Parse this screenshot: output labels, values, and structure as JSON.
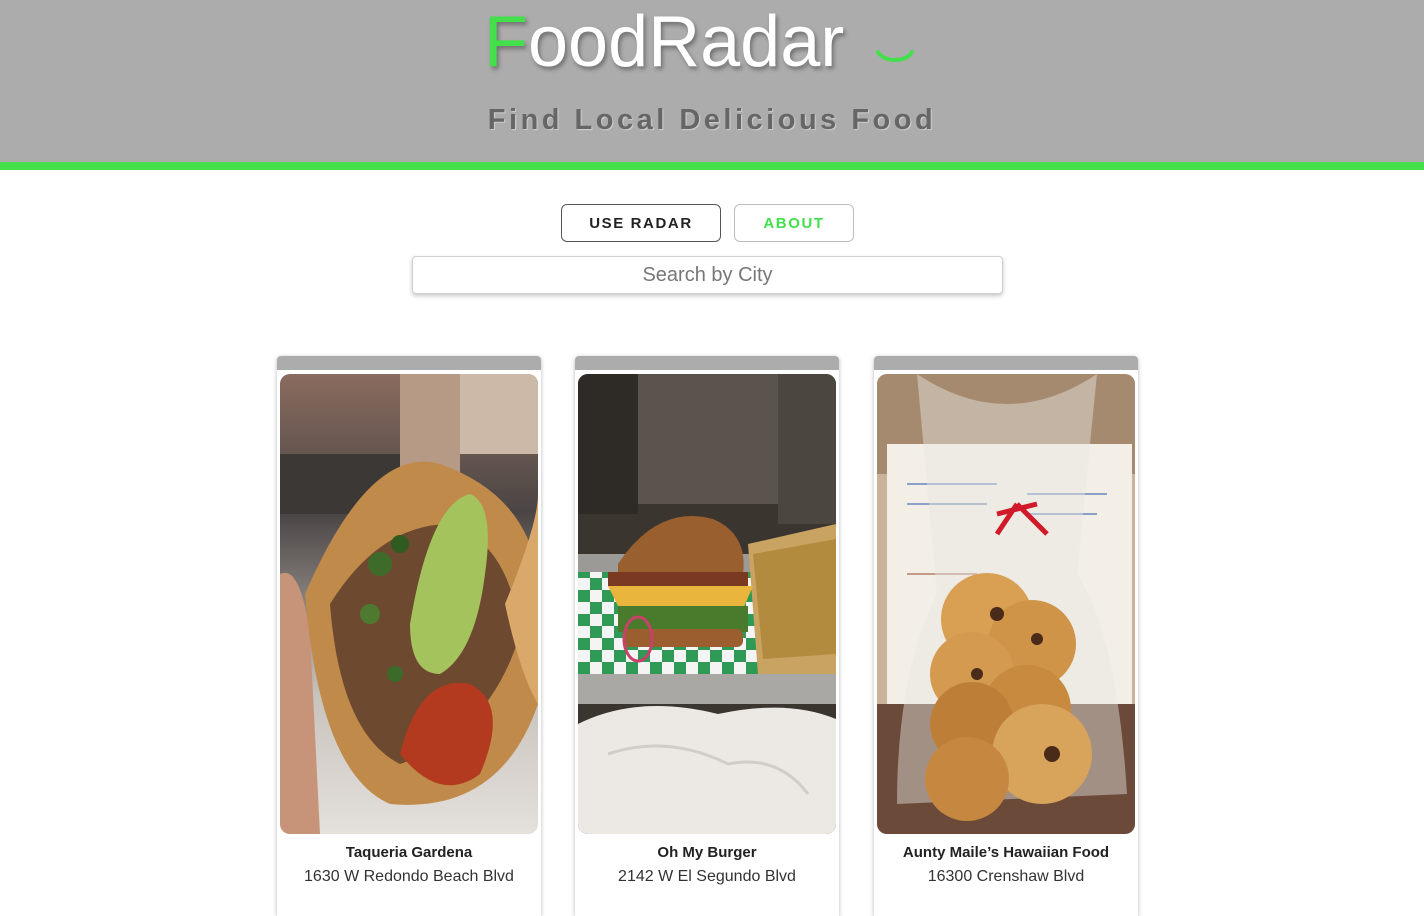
{
  "header": {
    "logo_first": "F",
    "logo_rest": "oodRadar",
    "tagline": "Find Local Delicious Food",
    "accent_color": "#43e04b",
    "background_color": "#acacac"
  },
  "nav": {
    "use_radar_label": "USE RADAR",
    "about_label": "ABOUT"
  },
  "search": {
    "placeholder": "Search by City",
    "value": ""
  },
  "restaurants": [
    {
      "name": "Taqueria Gardena",
      "address": "1630 W Redondo Beach Blvd",
      "photo": "taco-photo"
    },
    {
      "name": "Oh My Burger",
      "address": "2142 W El Segundo Blvd",
      "photo": "burger-photo"
    },
    {
      "name": "Aunty Maile’s Hawaiian Food",
      "address": "16300 Crenshaw Blvd",
      "photo": "cookies-photo"
    }
  ]
}
